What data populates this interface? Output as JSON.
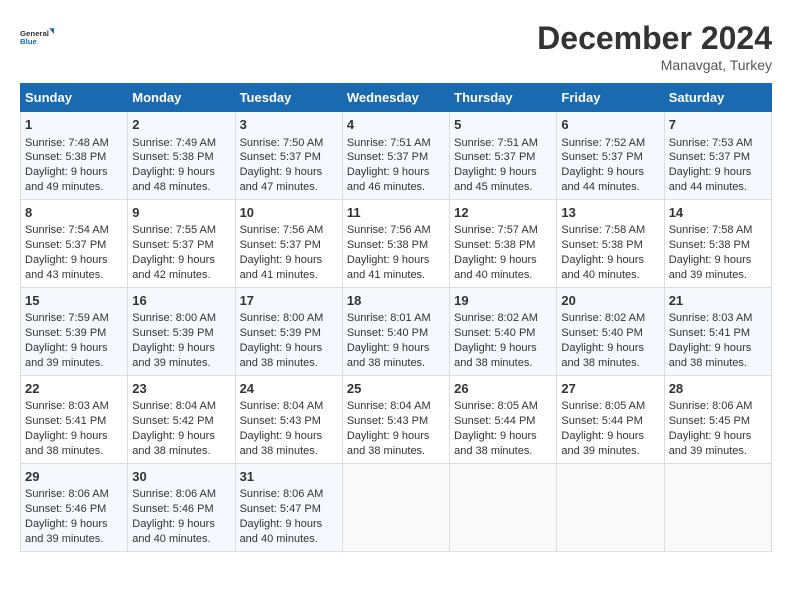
{
  "logo": {
    "line1": "General",
    "line2": "Blue"
  },
  "title": "December 2024",
  "subtitle": "Manavgat, Turkey",
  "days_header": [
    "Sunday",
    "Monday",
    "Tuesday",
    "Wednesday",
    "Thursday",
    "Friday",
    "Saturday"
  ],
  "weeks": [
    [
      {
        "day": "1",
        "lines": [
          "Sunrise: 7:48 AM",
          "Sunset: 5:38 PM",
          "Daylight: 9 hours",
          "and 49 minutes."
        ]
      },
      {
        "day": "2",
        "lines": [
          "Sunrise: 7:49 AM",
          "Sunset: 5:38 PM",
          "Daylight: 9 hours",
          "and 48 minutes."
        ]
      },
      {
        "day": "3",
        "lines": [
          "Sunrise: 7:50 AM",
          "Sunset: 5:37 PM",
          "Daylight: 9 hours",
          "and 47 minutes."
        ]
      },
      {
        "day": "4",
        "lines": [
          "Sunrise: 7:51 AM",
          "Sunset: 5:37 PM",
          "Daylight: 9 hours",
          "and 46 minutes."
        ]
      },
      {
        "day": "5",
        "lines": [
          "Sunrise: 7:51 AM",
          "Sunset: 5:37 PM",
          "Daylight: 9 hours",
          "and 45 minutes."
        ]
      },
      {
        "day": "6",
        "lines": [
          "Sunrise: 7:52 AM",
          "Sunset: 5:37 PM",
          "Daylight: 9 hours",
          "and 44 minutes."
        ]
      },
      {
        "day": "7",
        "lines": [
          "Sunrise: 7:53 AM",
          "Sunset: 5:37 PM",
          "Daylight: 9 hours",
          "and 44 minutes."
        ]
      }
    ],
    [
      {
        "day": "8",
        "lines": [
          "Sunrise: 7:54 AM",
          "Sunset: 5:37 PM",
          "Daylight: 9 hours",
          "and 43 minutes."
        ]
      },
      {
        "day": "9",
        "lines": [
          "Sunrise: 7:55 AM",
          "Sunset: 5:37 PM",
          "Daylight: 9 hours",
          "and 42 minutes."
        ]
      },
      {
        "day": "10",
        "lines": [
          "Sunrise: 7:56 AM",
          "Sunset: 5:37 PM",
          "Daylight: 9 hours",
          "and 41 minutes."
        ]
      },
      {
        "day": "11",
        "lines": [
          "Sunrise: 7:56 AM",
          "Sunset: 5:38 PM",
          "Daylight: 9 hours",
          "and 41 minutes."
        ]
      },
      {
        "day": "12",
        "lines": [
          "Sunrise: 7:57 AM",
          "Sunset: 5:38 PM",
          "Daylight: 9 hours",
          "and 40 minutes."
        ]
      },
      {
        "day": "13",
        "lines": [
          "Sunrise: 7:58 AM",
          "Sunset: 5:38 PM",
          "Daylight: 9 hours",
          "and 40 minutes."
        ]
      },
      {
        "day": "14",
        "lines": [
          "Sunrise: 7:58 AM",
          "Sunset: 5:38 PM",
          "Daylight: 9 hours",
          "and 39 minutes."
        ]
      }
    ],
    [
      {
        "day": "15",
        "lines": [
          "Sunrise: 7:59 AM",
          "Sunset: 5:39 PM",
          "Daylight: 9 hours",
          "and 39 minutes."
        ]
      },
      {
        "day": "16",
        "lines": [
          "Sunrise: 8:00 AM",
          "Sunset: 5:39 PM",
          "Daylight: 9 hours",
          "and 39 minutes."
        ]
      },
      {
        "day": "17",
        "lines": [
          "Sunrise: 8:00 AM",
          "Sunset: 5:39 PM",
          "Daylight: 9 hours",
          "and 38 minutes."
        ]
      },
      {
        "day": "18",
        "lines": [
          "Sunrise: 8:01 AM",
          "Sunset: 5:40 PM",
          "Daylight: 9 hours",
          "and 38 minutes."
        ]
      },
      {
        "day": "19",
        "lines": [
          "Sunrise: 8:02 AM",
          "Sunset: 5:40 PM",
          "Daylight: 9 hours",
          "and 38 minutes."
        ]
      },
      {
        "day": "20",
        "lines": [
          "Sunrise: 8:02 AM",
          "Sunset: 5:40 PM",
          "Daylight: 9 hours",
          "and 38 minutes."
        ]
      },
      {
        "day": "21",
        "lines": [
          "Sunrise: 8:03 AM",
          "Sunset: 5:41 PM",
          "Daylight: 9 hours",
          "and 38 minutes."
        ]
      }
    ],
    [
      {
        "day": "22",
        "lines": [
          "Sunrise: 8:03 AM",
          "Sunset: 5:41 PM",
          "Daylight: 9 hours",
          "and 38 minutes."
        ]
      },
      {
        "day": "23",
        "lines": [
          "Sunrise: 8:04 AM",
          "Sunset: 5:42 PM",
          "Daylight: 9 hours",
          "and 38 minutes."
        ]
      },
      {
        "day": "24",
        "lines": [
          "Sunrise: 8:04 AM",
          "Sunset: 5:43 PM",
          "Daylight: 9 hours",
          "and 38 minutes."
        ]
      },
      {
        "day": "25",
        "lines": [
          "Sunrise: 8:04 AM",
          "Sunset: 5:43 PM",
          "Daylight: 9 hours",
          "and 38 minutes."
        ]
      },
      {
        "day": "26",
        "lines": [
          "Sunrise: 8:05 AM",
          "Sunset: 5:44 PM",
          "Daylight: 9 hours",
          "and 38 minutes."
        ]
      },
      {
        "day": "27",
        "lines": [
          "Sunrise: 8:05 AM",
          "Sunset: 5:44 PM",
          "Daylight: 9 hours",
          "and 39 minutes."
        ]
      },
      {
        "day": "28",
        "lines": [
          "Sunrise: 8:06 AM",
          "Sunset: 5:45 PM",
          "Daylight: 9 hours",
          "and 39 minutes."
        ]
      }
    ],
    [
      {
        "day": "29",
        "lines": [
          "Sunrise: 8:06 AM",
          "Sunset: 5:46 PM",
          "Daylight: 9 hours",
          "and 39 minutes."
        ]
      },
      {
        "day": "30",
        "lines": [
          "Sunrise: 8:06 AM",
          "Sunset: 5:46 PM",
          "Daylight: 9 hours",
          "and 40 minutes."
        ]
      },
      {
        "day": "31",
        "lines": [
          "Sunrise: 8:06 AM",
          "Sunset: 5:47 PM",
          "Daylight: 9 hours",
          "and 40 minutes."
        ]
      },
      null,
      null,
      null,
      null
    ]
  ]
}
